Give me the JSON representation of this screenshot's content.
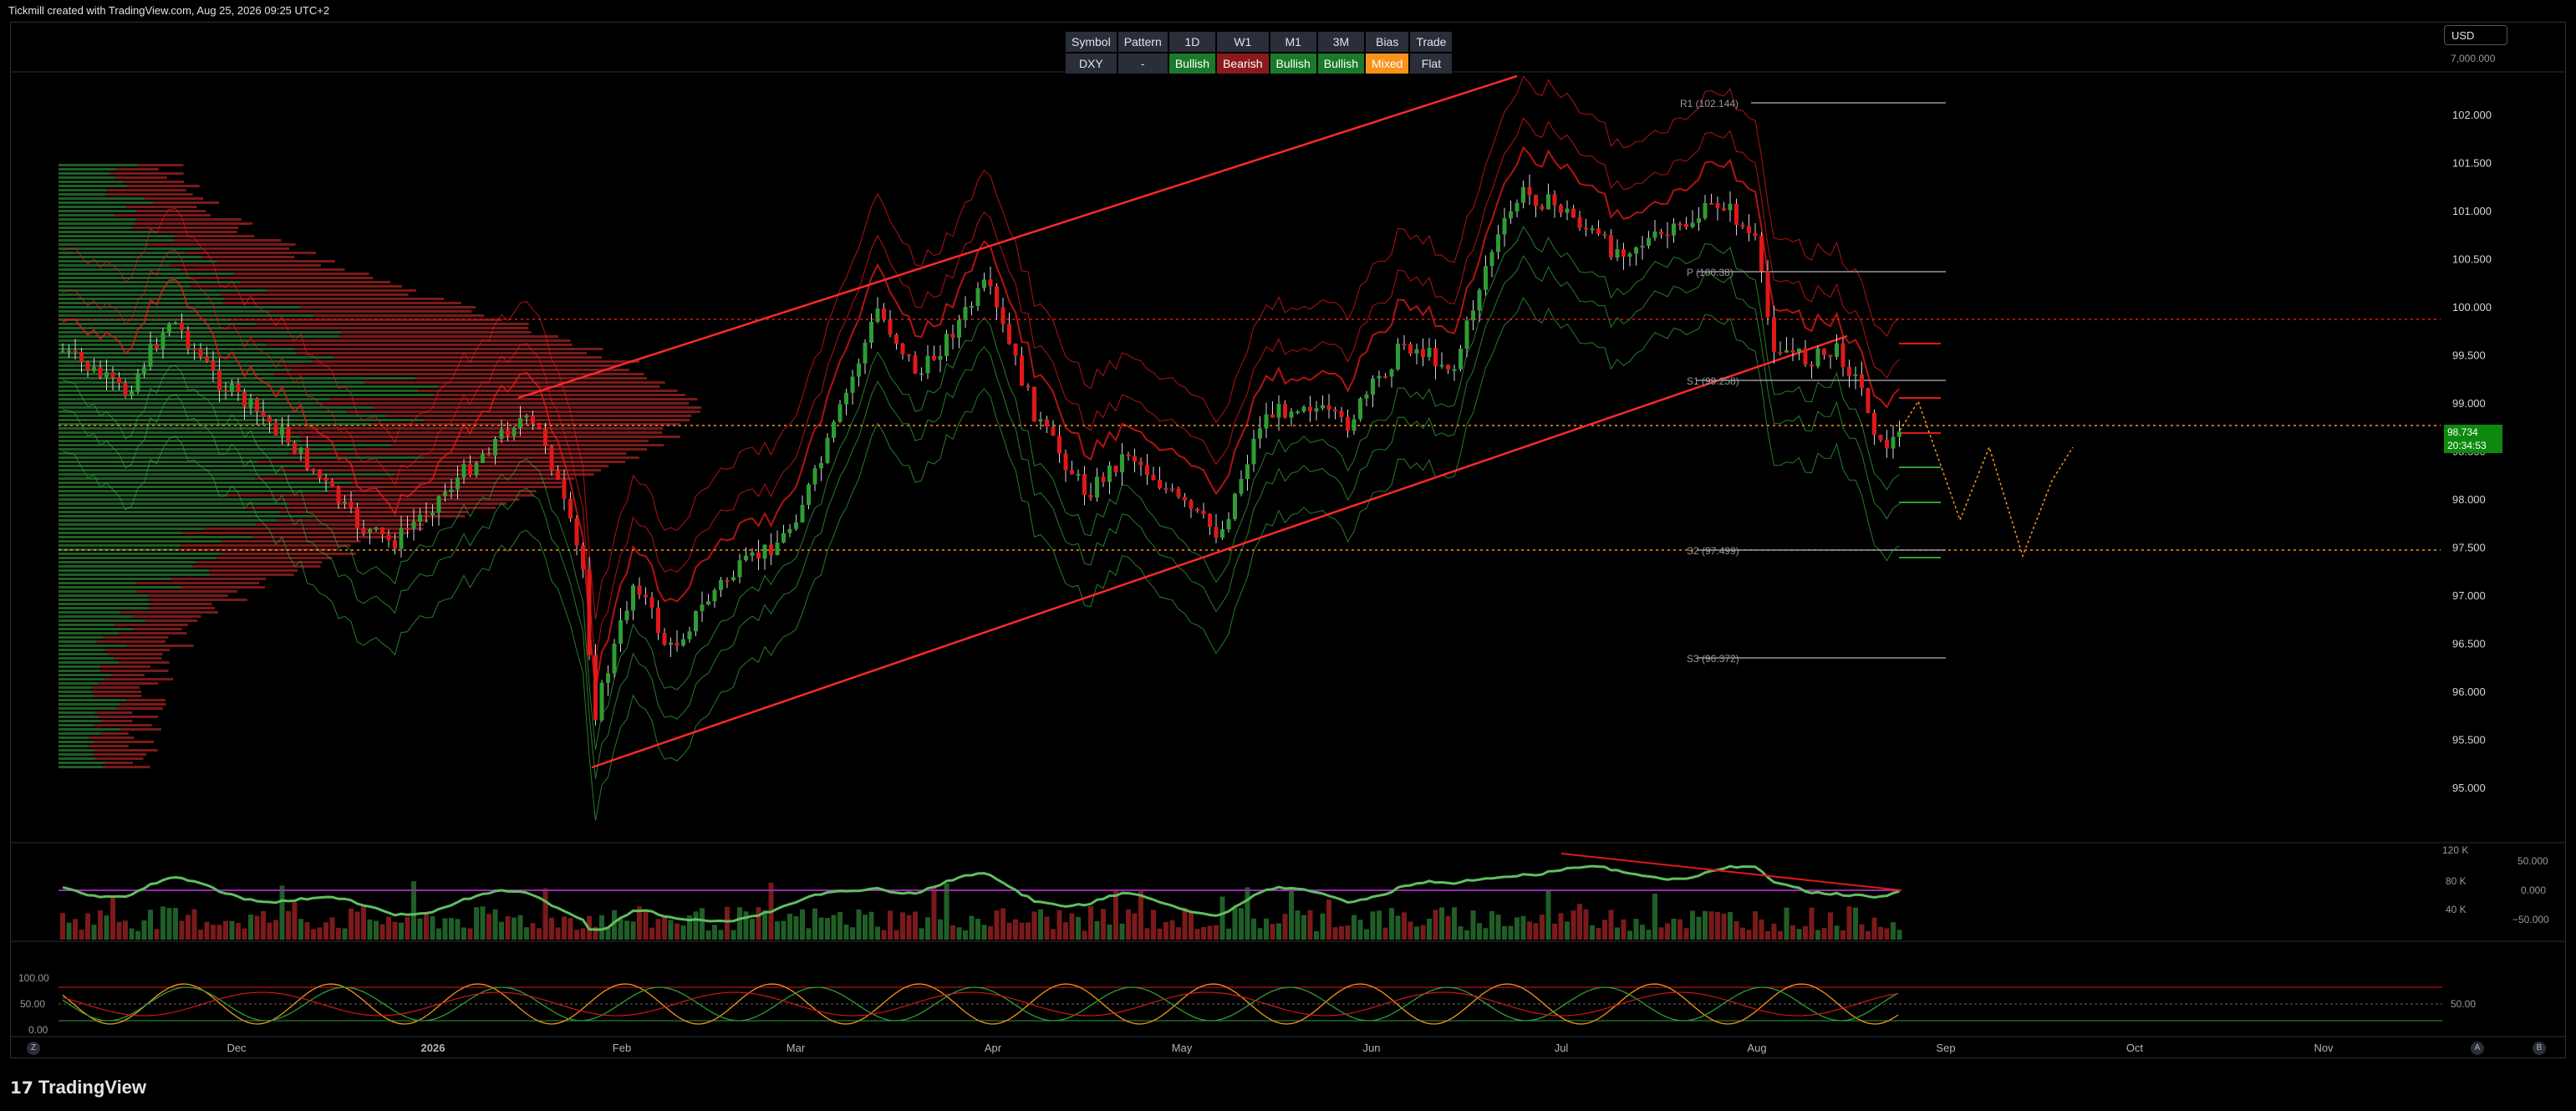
{
  "header": {
    "caption": "Tickmill created with TradingView.com, Aug 25, 2026 09:25 UTC+2"
  },
  "summary_table": {
    "headers": [
      "Symbol",
      "Pattern",
      "1D",
      "W1",
      "M1",
      "3M",
      "Bias",
      "Trade"
    ],
    "values": [
      "DXY",
      "-",
      "Bullish",
      "Bearish",
      "Bullish",
      "Bullish",
      "Mixed",
      "Flat"
    ]
  },
  "currency_select": {
    "value": "USD"
  },
  "price_axis": {
    "top_label": "7,000.000",
    "labels": [
      "102.000",
      "101.500",
      "101.000",
      "100.500",
      "100.000",
      "99.500",
      "99.000",
      "98.500",
      "98.000",
      "97.500",
      "97.000",
      "96.500",
      "96.000",
      "95.500",
      "95.000"
    ]
  },
  "last_price": {
    "price": "98.734",
    "countdown": "20:34:53"
  },
  "pivots": {
    "r1": "R1 (102.144)",
    "p": "P (100.38)",
    "s1": "S1 (99.258)",
    "s2": "S2 (97.499)",
    "s3": "S3 (96.372)"
  },
  "time_axis": {
    "labels": [
      "Dec",
      "2026",
      "Feb",
      "Mar",
      "Apr",
      "May",
      "Jun",
      "Jul",
      "Aug",
      "Sep",
      "Oct",
      "Nov"
    ]
  },
  "volume_axis": {
    "left": [
      "120 K",
      "80 K",
      "40 K"
    ],
    "right": [
      "50.000",
      "0.000",
      "−50.000"
    ]
  },
  "stoch_axis": {
    "left": [
      "100.00",
      "50.00",
      "0.00"
    ],
    "right": [
      "50.00"
    ]
  },
  "bottom_buttons": {
    "z": "Z",
    "a": "A",
    "b": "B"
  },
  "footer": {
    "brand": "TradingView"
  },
  "colors": {
    "bull": "#2e9c34",
    "bear": "#e01818",
    "pivot": "#9598a1",
    "orange": "#f7931a"
  }
}
